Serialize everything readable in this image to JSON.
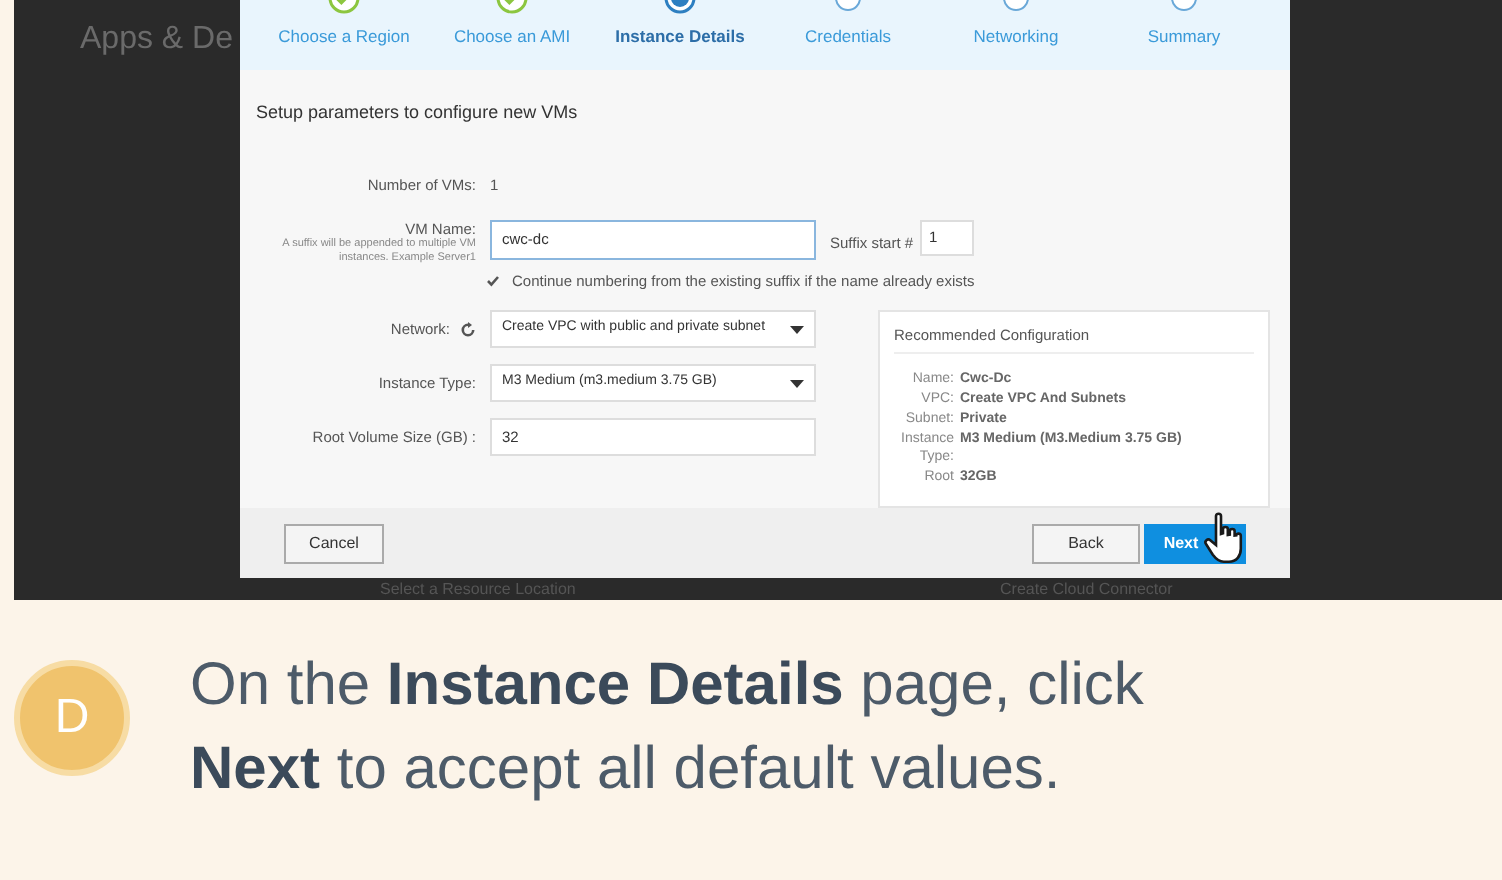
{
  "background": {
    "heading": "Apps & De",
    "resource_select": "Select a Resource Location",
    "connector_label": "Create Cloud Connector"
  },
  "dialog": {
    "steps": [
      {
        "label": "Choose a Region",
        "completed": true,
        "selected": false
      },
      {
        "label": "Choose an AMI",
        "completed": true,
        "selected": false
      },
      {
        "label": "Instance Details",
        "completed": false,
        "selected": true
      },
      {
        "label": "Credentials",
        "completed": false,
        "selected": false
      },
      {
        "label": "Networking",
        "completed": false,
        "selected": false
      },
      {
        "label": "Summary",
        "completed": false,
        "selected": false
      }
    ],
    "intro": "Setup parameters to configure new VMs",
    "vm_count": {
      "label": "Number of VMs:",
      "value": "1"
    },
    "vm_name": {
      "label": "VM Name:",
      "hint": "A suffix will be appended to multiple VM instances. Example Server1",
      "value": "cwc-dc"
    },
    "suffix": {
      "label": "Suffix start #",
      "value": "1"
    },
    "continue_numbering": {
      "label": "Continue numbering from the existing suffix if the name already exists",
      "checked": true
    },
    "network": {
      "label": "Network:",
      "value": "Create VPC with public and private subnet"
    },
    "instance_type": {
      "label": "Instance Type:",
      "value": "M3 Medium (m3.medium 3.75 GB)"
    },
    "root_volume": {
      "label": "Root Volume Size (GB) :",
      "value": "32"
    },
    "recommended": {
      "title": "Recommended Configuration",
      "rows": [
        {
          "label": "Name:",
          "value": "Cwc-Dc"
        },
        {
          "label": "VPC:",
          "value": "Create VPC And Subnets"
        },
        {
          "label": "Subnet:",
          "value": "Private"
        },
        {
          "label": "Instance Type:",
          "value": "M3 Medium (M3.Medium 3.75 GB)"
        },
        {
          "label": "Root",
          "value": "32GB"
        }
      ]
    },
    "buttons": {
      "cancel": "Cancel",
      "back": "Back",
      "next": "Next"
    }
  },
  "caption": {
    "badge": "D",
    "text": "On the **Instance Details** page, click **Next** to accept all default values."
  }
}
